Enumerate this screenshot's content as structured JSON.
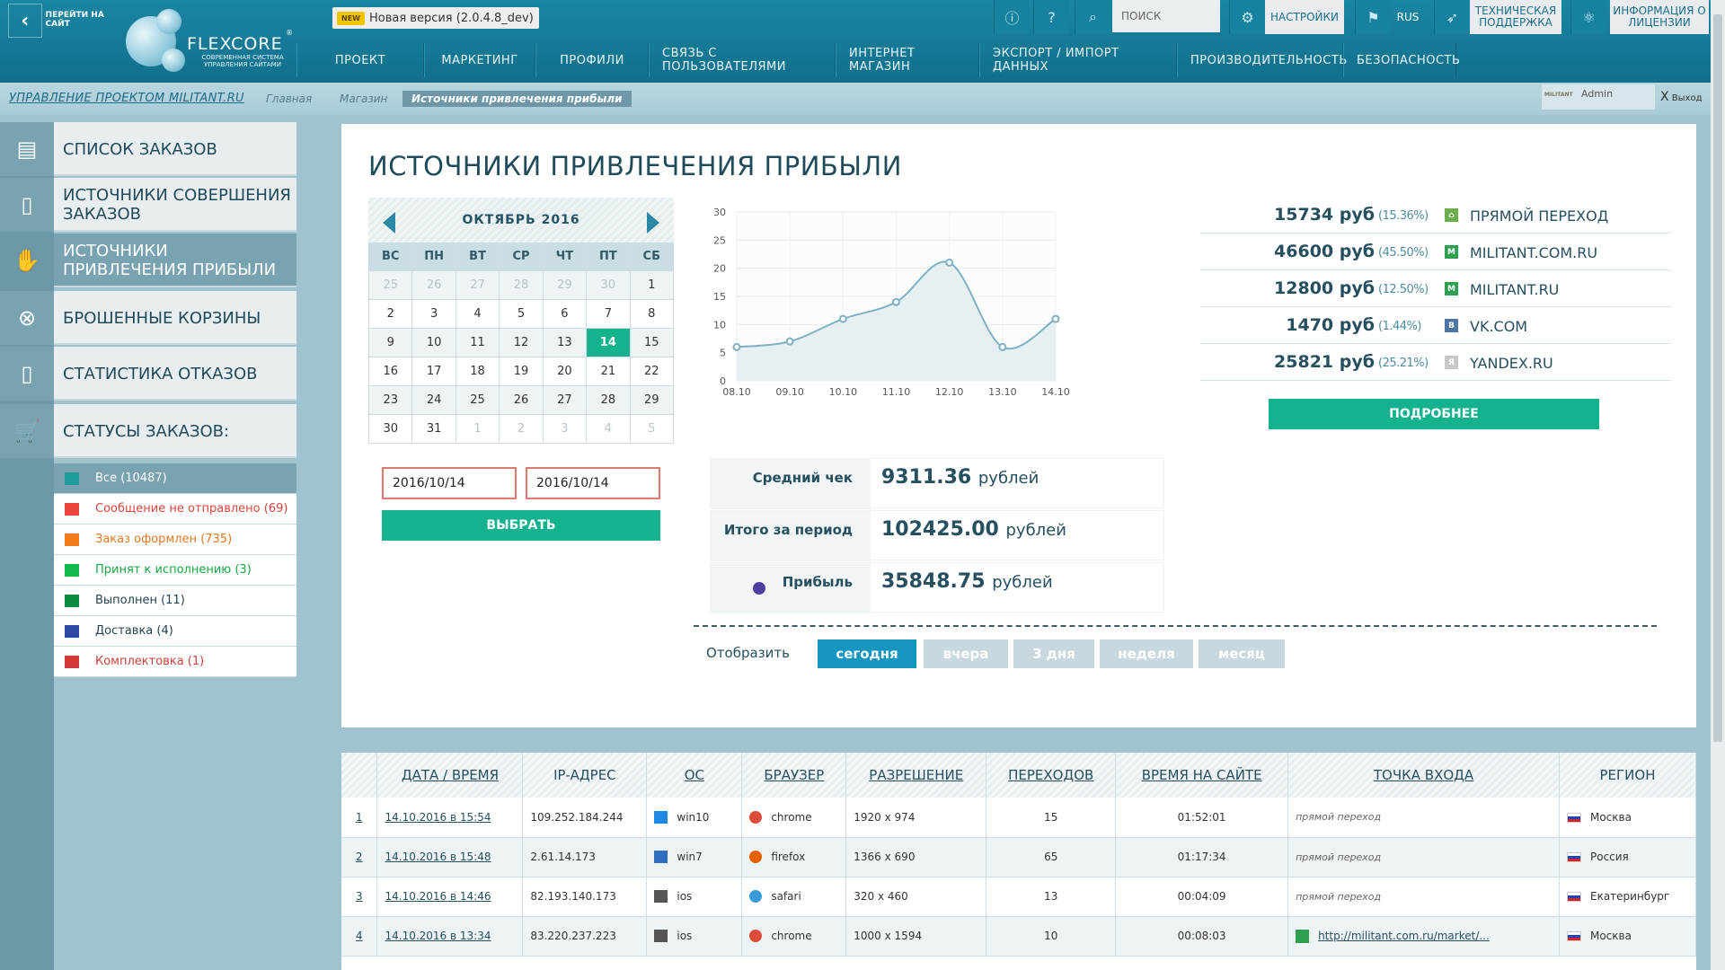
{
  "header": {
    "goto_site": "ПЕРЕЙТИ НА САЙТ",
    "logo_name": "FLEXCORE",
    "logo_sub": "СОВРЕМЕННАЯ СИСТЕМА УПРАВЛЕНИЯ САЙТАМИ",
    "logo_reg": "®",
    "new_badge": "NEW",
    "version": "Новая версия (2.0.4.8_dev)",
    "search_placeholder": "ПОИСК",
    "settings": "НАСТРОЙКИ",
    "lang": "RUS",
    "support": "ТЕХНИЧЕСКАЯ ПОДДЕРЖКА",
    "license": "ИНФОРМАЦИЯ О ЛИЦЕНЗИИ"
  },
  "nav": [
    "ПРОЕКТ",
    "МАРКЕТИНГ",
    "ПРОФИЛИ",
    "СВЯЗЬ С ПОЛЬЗОВАТЕЛЯМИ",
    "ИНТЕРНЕТ МАГАЗИН",
    "ЭКСПОРТ / ИМПОРТ ДАННЫХ",
    "ПРОИЗВОДИТЕЛЬНОСТЬ",
    "БЕЗОПАСНОСТЬ"
  ],
  "breadcrumb": {
    "project": "УПРАВЛЕНИЕ ПРОЕКТОМ MILITANT.RU",
    "items": [
      "Главная",
      "Магазин",
      "Источники привлечения прибыли"
    ]
  },
  "user": {
    "logo": "MILITANT",
    "name": "Admin",
    "logout": "Выход",
    "logout_x": "X"
  },
  "sidebar": {
    "items": [
      {
        "label": "СПИСОК ЗАКАЗОВ",
        "icon": "clipboard-icon"
      },
      {
        "label": "ИСТОЧНИКИ СОВЕРШЕНИЯ ЗАКАЗОВ",
        "icon": "devices-icon"
      },
      {
        "label": "ИСТОЧНИКИ ПРИВЛЕЧЕНИЯ ПРИБЫЛИ",
        "icon": "hand-money-icon"
      },
      {
        "label": "БРОШЕННЫЕ КОРЗИНЫ",
        "icon": "abandoned-cart-icon"
      },
      {
        "label": "СТАТИСТИКА ОТКАЗОВ",
        "icon": "devices-icon"
      },
      {
        "label": "СТАТУСЫ ЗАКАЗОВ:",
        "icon": "cart-check-icon"
      }
    ],
    "statuses": [
      {
        "label": "Все (10487)",
        "color": "#1e9b9b",
        "text_color": "#ffffff"
      },
      {
        "label": "Сообщение не отправлено (69)",
        "color": "#e8453c",
        "text_color": "#d9453c"
      },
      {
        "label": "Заказ оформлен (735)",
        "color": "#f07d1a",
        "text_color": "#e0781e"
      },
      {
        "label": "Принят к исполнению (3)",
        "color": "#15b84a",
        "text_color": "#17a645"
      },
      {
        "label": "Выполнен (11)",
        "color": "#0f8b3f",
        "text_color": "#24434f"
      },
      {
        "label": "Доставка (4)",
        "color": "#2f4aa3",
        "text_color": "#24434f"
      },
      {
        "label": "Комплектовка (1)",
        "color": "#d43a35",
        "text_color": "#c9403a"
      }
    ]
  },
  "main": {
    "title": "ИСТОЧНИКИ ПРИВЛЕЧЕНИЯ ПРИБЫЛИ",
    "calendar": {
      "month": "ОКТЯБРЬ  2016",
      "dow": [
        "ВС",
        "ПН",
        "ВТ",
        "СР",
        "ЧТ",
        "ПТ",
        "СБ"
      ],
      "weeks": [
        [
          "25",
          "26",
          "27",
          "28",
          "29",
          "30",
          "1"
        ],
        [
          "2",
          "3",
          "4",
          "5",
          "6",
          "7",
          "8"
        ],
        [
          "9",
          "10",
          "11",
          "12",
          "13",
          "14",
          "15"
        ],
        [
          "16",
          "17",
          "18",
          "19",
          "20",
          "21",
          "22"
        ],
        [
          "23",
          "24",
          "25",
          "26",
          "27",
          "28",
          "29"
        ],
        [
          "30",
          "31",
          "1",
          "2",
          "3",
          "4",
          "5"
        ]
      ],
      "selected": "14"
    },
    "date_from": "2016/10/14",
    "date_to": "2016/10/14",
    "select_label": "ВЫБРАТЬ",
    "stats": [
      {
        "label": "Средний чек",
        "value": "9311.36",
        "unit": "рублей"
      },
      {
        "label": "Итого за период",
        "value": "102425.00",
        "unit": "рублей"
      },
      {
        "label": "Прибыль",
        "value": "35848.75",
        "unit": "рублей"
      }
    ],
    "show_label": "Отобразить",
    "periods": [
      "сегодня",
      "вчера",
      "3 дня",
      "неделя",
      "месяц"
    ],
    "active_period": "сегодня",
    "sources": [
      {
        "amount": "15734 руб",
        "pct": "(15.36%)",
        "name": "ПРЯМОЙ ПЕРЕХОД",
        "icon": "house-icon",
        "color": "#6ab04c"
      },
      {
        "amount": "46600 руб",
        "pct": "(45.50%)",
        "name": "MILITANT.COM.RU",
        "icon": "militant-icon",
        "color": "#2fa04f"
      },
      {
        "amount": "12800 руб",
        "pct": "(12.50%)",
        "name": "MILITANT.RU",
        "icon": "militant-icon",
        "color": "#2fa04f"
      },
      {
        "amount": "1470 руб",
        "pct": "(1.44%)",
        "name": "VK.COM",
        "icon": "vk-icon",
        "color": "#4c75a3"
      },
      {
        "amount": "25821 руб",
        "pct": "(25.21%)",
        "name": "YANDEX.RU",
        "icon": "yandex-icon",
        "color": "#c8c8c8"
      }
    ],
    "more_label": "ПОДРОБНЕЕ"
  },
  "chart_data": {
    "type": "area",
    "x": [
      "08.10",
      "09.10",
      "10.10",
      "11.10",
      "12.10",
      "13.10",
      "14.10"
    ],
    "values": [
      6,
      7,
      11,
      14,
      21,
      6,
      11
    ],
    "ylim": [
      0,
      30
    ],
    "yticks": [
      0,
      5,
      10,
      15,
      20,
      25,
      30
    ],
    "grid": true,
    "color": "#7fb0c4"
  },
  "table": {
    "headers": [
      "",
      "ДАТА / ВРЕМЯ",
      "IP-АДРЕС",
      "ОС",
      "БРАУЗЕР",
      "РАЗРЕШЕНИЕ",
      "ПЕРЕХОДОВ",
      "ВРЕМЯ НА САЙТЕ",
      "ТОЧКА ВХОДА",
      "РЕГИОН"
    ],
    "rows": [
      {
        "n": "1",
        "date": "14.10.2016 в 15:54",
        "ip": "109.252.184.244",
        "os": "win10",
        "browser": "chrome",
        "res": "1920 x 974",
        "visits": "15",
        "time": "01:52:01",
        "entry": "прямой переход",
        "entry_link": false,
        "region": "Москва"
      },
      {
        "n": "2",
        "date": "14.10.2016 в 15:48",
        "ip": "2.61.14.173",
        "os": "win7",
        "browser": "firefox",
        "res": "1366 x 690",
        "visits": "65",
        "time": "01:17:34",
        "entry": "прямой переход",
        "entry_link": false,
        "region": "Россия"
      },
      {
        "n": "3",
        "date": "14.10.2016 в 14:46",
        "ip": "82.193.140.173",
        "os": "ios",
        "browser": "safari",
        "res": "320 x 460",
        "visits": "13",
        "time": "00:04:09",
        "entry": "прямой переход",
        "entry_link": false,
        "region": "Екатеринбург"
      },
      {
        "n": "4",
        "date": "14.10.2016 в 13:34",
        "ip": "83.220.237.223",
        "os": "ios",
        "browser": "chrome",
        "res": "1000 x 1594",
        "visits": "10",
        "time": "00:08:03",
        "entry": "http://militant.com.ru/market/...",
        "entry_link": true,
        "region": "Москва"
      }
    ]
  }
}
